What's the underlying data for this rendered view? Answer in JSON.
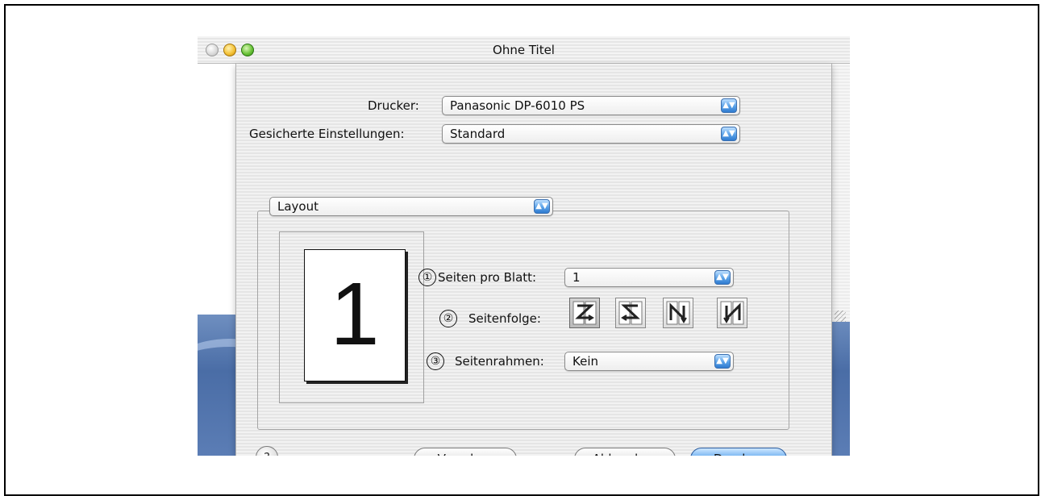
{
  "window": {
    "title": "Ohne Titel"
  },
  "printer": {
    "label": "Drucker:",
    "value": "Panasonic DP-6010 PS"
  },
  "presets": {
    "label": "Gesicherte Einstellungen:",
    "value": "Standard"
  },
  "panel": {
    "value": "Layout"
  },
  "preview": {
    "page_number": "1"
  },
  "callouts": [
    "①",
    "②",
    "③"
  ],
  "pages_per_sheet": {
    "label": "Seiten pro Blatt:",
    "value": "1"
  },
  "page_order": {
    "label": "Seitenfolge:",
    "options": [
      "z-order-icon",
      "reverse-z-order-icon",
      "n-order-icon",
      "reverse-n-order-icon"
    ],
    "selected_index": 0
  },
  "border": {
    "label": "Seitenrahmen:",
    "value": "Kein"
  },
  "buttons": {
    "help": "?",
    "preview": "Vorschau",
    "cancel": "Abbrechen",
    "print": "Drucken"
  },
  "colors": {
    "accent": "#3a86d8",
    "desktop": "#4a6da6"
  }
}
